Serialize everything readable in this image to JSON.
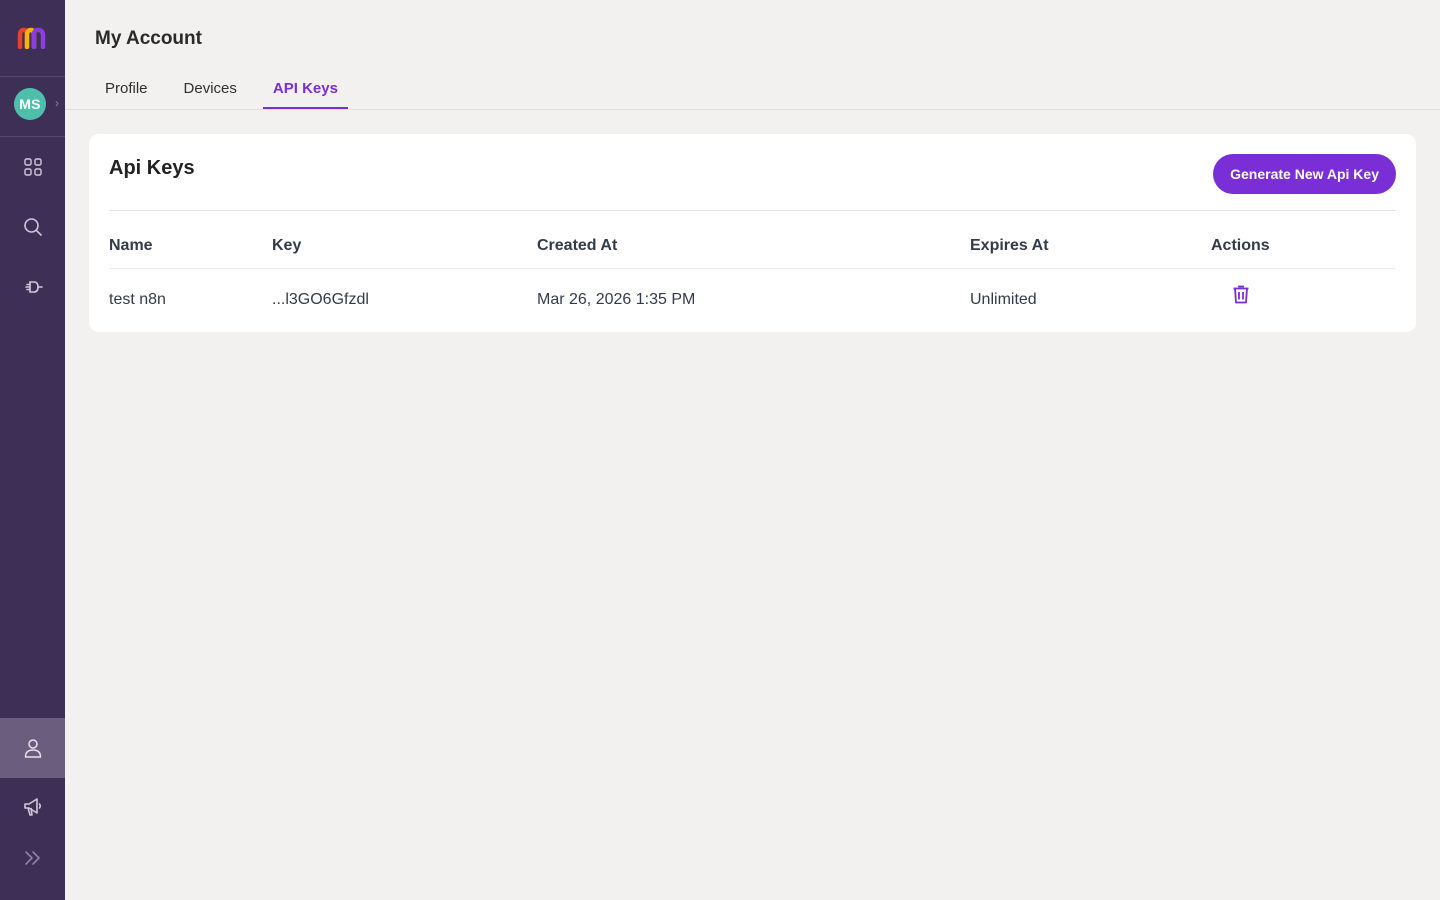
{
  "sidebar": {
    "logo_icon": "brand-logo-m",
    "avatar_initials": "MS",
    "items": [
      {
        "icon": "grid-icon",
        "label": ""
      },
      {
        "icon": "search-icon",
        "label": ""
      },
      {
        "icon": "plug-icon",
        "label": ""
      },
      {
        "icon": "user-icon",
        "label": "",
        "active": true
      },
      {
        "icon": "megaphone-icon",
        "label": ""
      },
      {
        "icon": "double-chevron-right-icon",
        "label": ""
      }
    ]
  },
  "header": {
    "title": "My Account"
  },
  "tabs": [
    {
      "label": "Profile",
      "active": false
    },
    {
      "label": "Devices",
      "active": false
    },
    {
      "label": "API Keys",
      "active": true
    }
  ],
  "api_keys_card": {
    "title": "Api Keys",
    "generate_button_label": "Generate New Api Key",
    "columns": [
      "Name",
      "Key",
      "Created At",
      "Expires At",
      "Actions"
    ],
    "rows": [
      {
        "name": "test n8n",
        "key": "...l3GO6Gfzdl",
        "created_at": "Mar 26, 2026 1:35 PM",
        "expires_at": "Unlimited",
        "action_icon": "trash-icon"
      }
    ]
  },
  "colors": {
    "sidebar_bg": "#3e2f56",
    "accent": "#7a2fd6",
    "avatar_bg": "#4dbfaa",
    "page_bg": "#f2f1ef"
  }
}
